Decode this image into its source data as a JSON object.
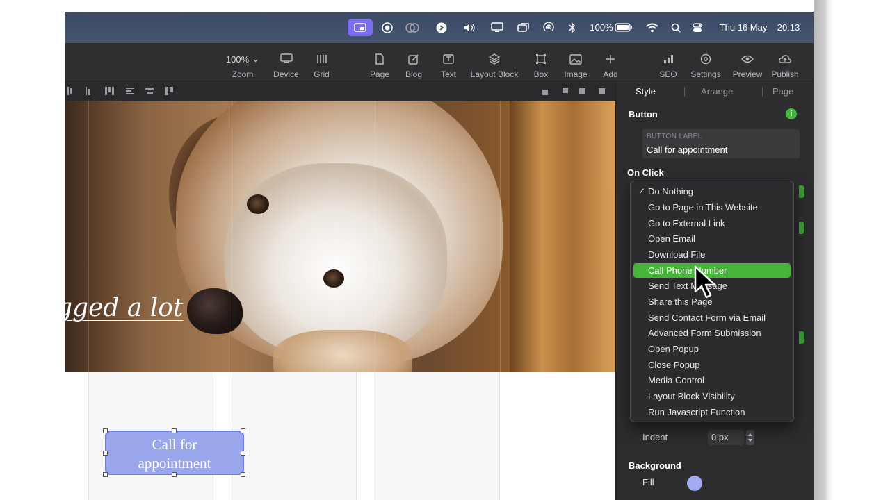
{
  "menubar": {
    "battery": "100%",
    "date": "Thu 16 May",
    "time": "20:13",
    "icons": [
      "screen-share-icon",
      "record-icon",
      "airplay-overlay-icon",
      "shazam-icon",
      "volume-icon",
      "display-icon",
      "screen-mirror-icon",
      "airdrop-icon",
      "bluetooth-icon",
      "battery-icon",
      "wifi-icon",
      "search-icon",
      "control-center-icon"
    ]
  },
  "toolbar": {
    "zoom_value": "100%",
    "zoom_label": "Zoom",
    "device_label": "Device",
    "grid_label": "Grid",
    "page_label": "Page",
    "blog_label": "Blog",
    "text_label": "Text",
    "layout_block_label": "Layout Block",
    "box_label": "Box",
    "image_label": "Image",
    "add_label": "Add",
    "seo_label": "SEO",
    "settings_label": "Settings",
    "preview_label": "Preview",
    "publish_label": "Publish"
  },
  "canvas": {
    "script_text": "gged a lot",
    "button_text_line1": "Call for",
    "button_text_line2": "appointment"
  },
  "panel": {
    "tabs": [
      "Style",
      "Arrange",
      "Page"
    ],
    "active_tab": "Style",
    "button_section_title": "Button",
    "info_icon_text": "i",
    "button_label_caption": "BUTTON LABEL",
    "button_label_value": "Call for appointment",
    "on_click_title": "On Click",
    "indent_label": "Indent",
    "indent_value": "0 px",
    "background_title": "Background",
    "fill_label": "Fill",
    "fill_color": "#a4acf0"
  },
  "dropdown": {
    "checked": "Do Nothing",
    "selected": "Call Phone Number",
    "options": [
      "Do Nothing",
      "Go to Page in This Website",
      "Go to External Link",
      "Open Email",
      "Download File",
      "Call Phone Number",
      "Send Text Message",
      "Share this Page",
      "Send Contact Form via Email",
      "Advanced Form Submission",
      "Open Popup",
      "Close Popup",
      "Media Control",
      "Layout Block Visibility",
      "Run Javascript Function"
    ]
  },
  "colors": {
    "accent_green": "#48b43a",
    "menubar_active": "#7b6cf0",
    "button_fill": "#9aa6ec"
  }
}
